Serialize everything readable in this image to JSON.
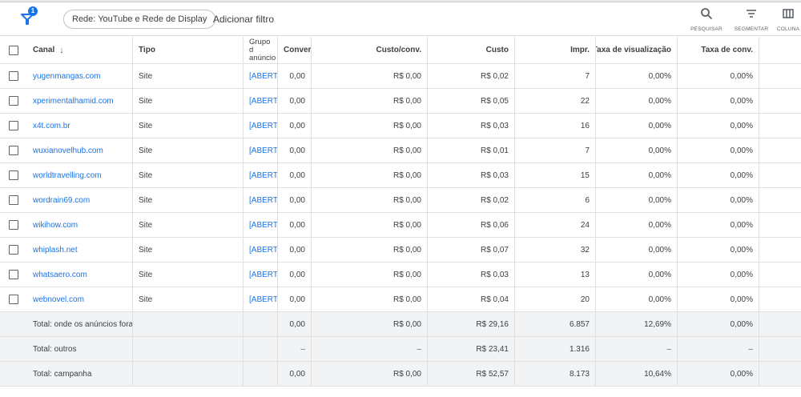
{
  "toolbar": {
    "filter_badge": "1",
    "network_chip": "Rede: YouTube e Rede de Display",
    "add_filter": "Adicionar filtro",
    "tools": [
      {
        "label": "PESQUISAR",
        "icon": "search-icon"
      },
      {
        "label": "SEGMENTAR",
        "icon": "segment-icon"
      },
      {
        "label": "COLUNA",
        "icon": "columns-icon"
      }
    ]
  },
  "table": {
    "headers": {
      "canal": "Canal",
      "tipo": "Tipo",
      "grupo": "Grupo d anúncio",
      "conv": "Conver",
      "custo_conv": "Custo/conv.",
      "custo": "Custo",
      "impr": "Impr.",
      "taxa_vis": "Taxa de visualização",
      "taxa_conv": "Taxa de conv."
    },
    "rows": [
      {
        "canal": "yugenmangas.com",
        "tipo": "Site",
        "grupo": "[ABERT",
        "conv": "0,00",
        "custo_conv": "R$ 0,00",
        "custo": "R$ 0,02",
        "impr": "7",
        "taxa_vis": "0,00%",
        "taxa_conv": "0,00%"
      },
      {
        "canal": "xperimentalhamid.com",
        "tipo": "Site",
        "grupo": "[ABERT",
        "conv": "0,00",
        "custo_conv": "R$ 0,00",
        "custo": "R$ 0,05",
        "impr": "22",
        "taxa_vis": "0,00%",
        "taxa_conv": "0,00%"
      },
      {
        "canal": "x4t.com.br",
        "tipo": "Site",
        "grupo": "[ABERT",
        "conv": "0,00",
        "custo_conv": "R$ 0,00",
        "custo": "R$ 0,03",
        "impr": "16",
        "taxa_vis": "0,00%",
        "taxa_conv": "0,00%"
      },
      {
        "canal": "wuxianovelhub.com",
        "tipo": "Site",
        "grupo": "[ABERT",
        "conv": "0,00",
        "custo_conv": "R$ 0,00",
        "custo": "R$ 0,01",
        "impr": "7",
        "taxa_vis": "0,00%",
        "taxa_conv": "0,00%"
      },
      {
        "canal": "worldtravelling.com",
        "tipo": "Site",
        "grupo": "[ABERT",
        "conv": "0,00",
        "custo_conv": "R$ 0,00",
        "custo": "R$ 0,03",
        "impr": "15",
        "taxa_vis": "0,00%",
        "taxa_conv": "0,00%"
      },
      {
        "canal": "wordrain69.com",
        "tipo": "Site",
        "grupo": "[ABERT",
        "conv": "0,00",
        "custo_conv": "R$ 0,00",
        "custo": "R$ 0,02",
        "impr": "6",
        "taxa_vis": "0,00%",
        "taxa_conv": "0,00%"
      },
      {
        "canal": "wikihow.com",
        "tipo": "Site",
        "grupo": "[ABERT",
        "conv": "0,00",
        "custo_conv": "R$ 0,00",
        "custo": "R$ 0,06",
        "impr": "24",
        "taxa_vis": "0,00%",
        "taxa_conv": "0,00%"
      },
      {
        "canal": "whiplash.net",
        "tipo": "Site",
        "grupo": "[ABERT",
        "conv": "0,00",
        "custo_conv": "R$ 0,00",
        "custo": "R$ 0,07",
        "impr": "32",
        "taxa_vis": "0,00%",
        "taxa_conv": "0,00%"
      },
      {
        "canal": "whatsaero.com",
        "tipo": "Site",
        "grupo": "[ABERT",
        "conv": "0,00",
        "custo_conv": "R$ 0,00",
        "custo": "R$ 0,03",
        "impr": "13",
        "taxa_vis": "0,00%",
        "taxa_conv": "0,00%"
      },
      {
        "canal": "webnovel.com",
        "tipo": "Site",
        "grupo": "[ABERT",
        "conv": "0,00",
        "custo_conv": "R$ 0,00",
        "custo": "R$ 0,04",
        "impr": "20",
        "taxa_vis": "0,00%",
        "taxa_conv": "0,00%"
      }
    ],
    "totals": [
      {
        "label": "Total: onde os anúncios fora...",
        "conv": "0,00",
        "custo_conv": "R$ 0,00",
        "custo": "R$ 29,16",
        "impr": "6.857",
        "taxa_vis": "12,69%",
        "taxa_conv": "0,00%"
      },
      {
        "label": "Total: outros",
        "conv": "–",
        "custo_conv": "–",
        "custo": "R$ 23,41",
        "impr": "1.316",
        "taxa_vis": "–",
        "taxa_conv": "–"
      },
      {
        "label": "Total: campanha",
        "conv": "0,00",
        "custo_conv": "R$ 0,00",
        "custo": "R$ 52,57",
        "impr": "8.173",
        "taxa_vis": "10,64%",
        "taxa_conv": "0,00%"
      }
    ]
  },
  "colors": {
    "link": "#1a73e8",
    "total_bg": "#f1f3f4",
    "border": "#e0e0e0"
  }
}
